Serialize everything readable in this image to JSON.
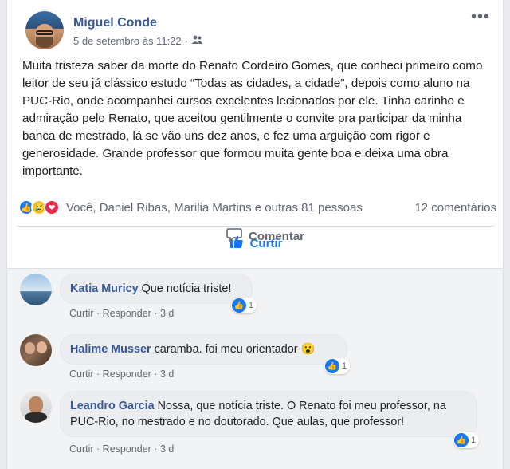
{
  "post": {
    "author": "Miguel Conde",
    "timestamp": "5 de setembro às 11:22",
    "separator": "·",
    "audience_icon": "friends-icon",
    "more_label": "•••",
    "text": "Muita tristeza saber da morte do Renato Cordeiro Gomes, que conheci primeiro como leitor de seu já clássico estudo “Todas as cidades, a cidade”, depois como aluno na PUC-Rio, onde acompanhei cursos excelentes lecionados por ele. Tinha carinho e admiração pelo Renato, que aceitou gentilmente o convite pra participar da minha banca de mestrado, lá se vão uns dez anos, e fez uma arguição com rigor e generosidade. Grande professor que formou muita gente boa e deixa uma obra importante."
  },
  "reactions": {
    "icons": [
      "like-reaction-icon",
      "sad-reaction-icon",
      "love-reaction-icon"
    ],
    "names": "Você, Daniel Ribas, Marilia Martins e outras 81 pessoas",
    "comment_count": "12 comentários"
  },
  "actions": {
    "like_label": "Curtir",
    "comment_label": "Comentar"
  },
  "comments": [
    {
      "author": "Katia Muricy",
      "text": "Que notícia triste!",
      "reply_like": "Curtir",
      "reply_reply": "Responder",
      "age": "3 d",
      "likes": "1"
    },
    {
      "author": "Halime Musser",
      "text": "caramba. foi meu orientador 😮",
      "reply_like": "Curtir",
      "reply_reply": "Responder",
      "age": "3 d",
      "likes": "1"
    },
    {
      "author": "Leandro Garcia",
      "text": "Nossa, que notícia triste. O Renato foi meu professor, na PUC-Rio, no mestrado e no doutorado. Que aulas, que professor!",
      "reply_like": "Curtir",
      "reply_reply": "Responder",
      "age": "3 d",
      "likes": "1"
    }
  ],
  "colors": {
    "link_blue": "#385898",
    "like_blue": "#1877f2",
    "love_red": "#f0284a",
    "sad_yellow": "#f7c240"
  }
}
